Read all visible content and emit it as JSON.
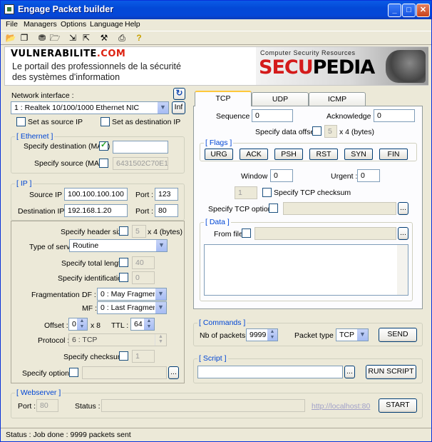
{
  "window": {
    "title": "Engage Packet builder"
  },
  "menu": [
    "File",
    "Managers",
    "Options",
    "Language",
    "Help"
  ],
  "banner": {
    "brand_main": "VULNERABILITE",
    "brand_suffix": ".COM",
    "line1": "Le portail des professionnels de la sécurité",
    "line2": "des systèmes d'information",
    "tagline": "Computer Security Resources",
    "logo_left": "SECU",
    "logo_right": "PEDIA"
  },
  "network": {
    "label": "Network interface :",
    "selected": "1 :  Realtek 10/100/1000 Ethernet NIC",
    "inf_button": "Inf",
    "set_source": "Set as source IP",
    "set_destination": "Set as destination IP"
  },
  "ethernet": {
    "title": "[ Ethernet ]",
    "dest_label": "Specify destination (MAC)",
    "dest_value": "",
    "src_label": "Specify source (MAC)",
    "src_value": "6431502C70E1"
  },
  "ip": {
    "title": "[ IP ]",
    "source_label": "Source IP :",
    "source_value": "100.100.100.100",
    "source_port_label": "Port :",
    "source_port": "123",
    "dest_label": "Destination IP :",
    "dest_value": "192.168.1.20",
    "dest_port_label": "Port :",
    "dest_port": "80"
  },
  "ipopts": {
    "header_size_label": "Specify header size",
    "header_size": "5",
    "header_unit": "x 4 (bytes)",
    "tos_label": "Type of service :",
    "tos_value": "Routine",
    "total_length_label": "Specify total length",
    "total_length": "40",
    "ident_label": "Specify identification",
    "ident": "0",
    "frag_label": "Fragmentation :",
    "df_label": "DF :",
    "df_value": "0 : May Fragment",
    "mf_label": "MF :",
    "mf_value": "0 : Last Fragment",
    "offset_label": "Offset :",
    "offset": "0",
    "offset_unit": "x 8",
    "ttl_label": "TTL :",
    "ttl": "64",
    "protocol_label": "Protocol :",
    "protocol": "6 : TCP",
    "checksum_label": "Specify checksum",
    "checksum": "1",
    "options_label": "Specify options",
    "browse": "..."
  },
  "tabs": [
    "TCP",
    "UDP",
    "ICMP"
  ],
  "tcp": {
    "seq_label": "Sequence :",
    "seq": "0",
    "ack_label": "Acknowledge :",
    "ack": "0",
    "offset_label": "Specify data offset",
    "offset": "5",
    "offset_unit": "x 4 (bytes)",
    "flags_title": "[ Flags ]",
    "flags": [
      "URG",
      "ACK",
      "PSH",
      "RST",
      "SYN",
      "FIN"
    ],
    "window_label": "Window :",
    "window": "0",
    "urgent_label": "Urgent :",
    "urgent": "0",
    "checksum": "1",
    "checksum_label": "Specify TCP checksum",
    "options_label": "Specify TCP options",
    "data_title": "[ Data ]",
    "from_file_label": "From file",
    "browse": "..."
  },
  "commands": {
    "title": "[ Commands ]",
    "nb_label": "Nb of packets :",
    "nb": "9999",
    "type_label": "Packet type :",
    "type": "TCP",
    "send": "SEND"
  },
  "script": {
    "title": "[ Script ]",
    "browse": "...",
    "run": "RUN SCRIPT"
  },
  "webserver": {
    "title": "[ Webserver ]",
    "port_label": "Port :",
    "port": "80",
    "status_label": "Status :",
    "link": "http://localhost:80",
    "start": "START"
  },
  "status": "Status :  Job done : 9999 packets sent"
}
